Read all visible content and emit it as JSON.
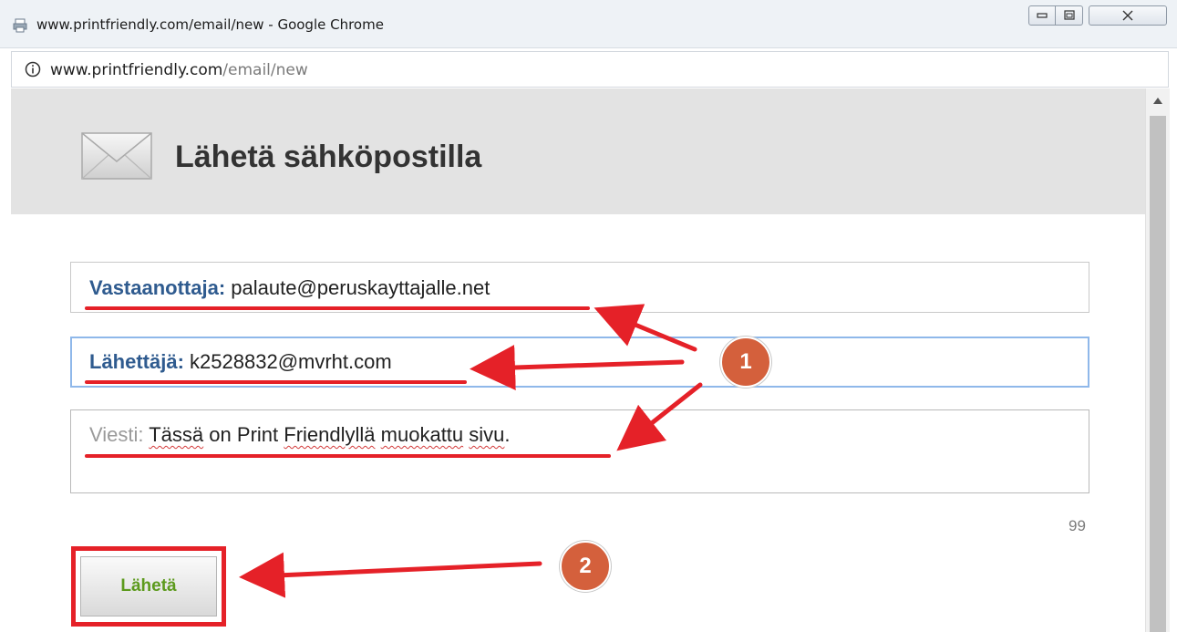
{
  "window": {
    "title": "www.printfriendly.com/email/new - Google Chrome",
    "controls": [
      "minimize-icon",
      "maximize-icon",
      "close-icon"
    ]
  },
  "address_bar": {
    "url_host": "www.printfriendly.com",
    "url_path": "/email/new"
  },
  "page": {
    "title": "Lähetä sähköpostilla",
    "to_label": "Vastaanottaja:",
    "to_value": "palaute@peruskayttajalle.net",
    "from_label": "Lähettäjä:",
    "from_value": "k2528832@mvrht.com",
    "message_label": "Viesti:",
    "message_words": [
      "Tässä",
      "on",
      "Print",
      "Friendlyllä",
      "muokattu",
      "sivu"
    ],
    "message_end": ".",
    "char_counter": "99",
    "send_label": "Lähetä"
  },
  "annotations": {
    "badge_1": "1",
    "badge_2": "2",
    "color_highlight": "#e52128",
    "color_badge": "#d4603c"
  },
  "colors": {
    "label_blue": "#2f5b8f",
    "send_green": "#5c9a1d",
    "header_band": "#e3e3e3"
  }
}
